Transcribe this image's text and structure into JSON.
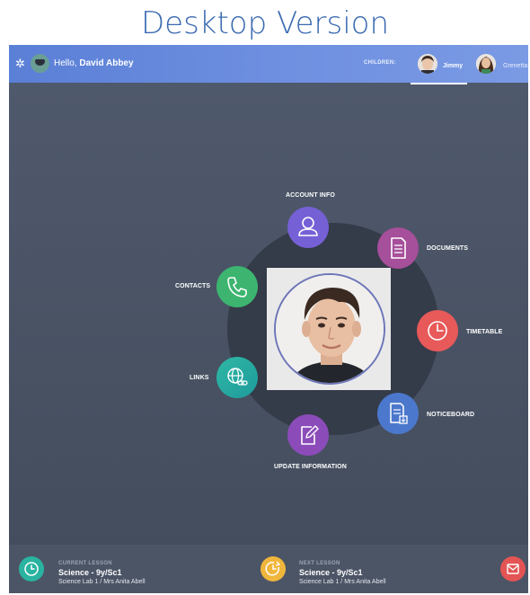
{
  "page_title": "Desktop Version",
  "topbar": {
    "greeting_prefix": "Hello, ",
    "user_name": "David Abbey",
    "children_label": "CHILDREN:",
    "children": [
      {
        "name": "Jimmy",
        "active": true
      },
      {
        "name": "Grenetta",
        "active": false
      }
    ]
  },
  "menu": {
    "account_info": "ACCOUNT INFO",
    "documents": "DOCUMENTS",
    "timetable": "TIMETABLE",
    "noticeboard": "NOTICEBOARD",
    "update_information": "UPDATE INFORMATION",
    "links": "LINKS",
    "contacts": "CONTACTS"
  },
  "lessons": {
    "current": {
      "kicker": "CURRENT LESSON",
      "title": "Science - 9y/Sc1",
      "subtitle": "Science Lab 1 / Mrs Anita Abell"
    },
    "next": {
      "kicker": "NEXT LESSON",
      "title": "Science - 9y/Sc1",
      "subtitle": "Science Lab 1 / Mrs Anita Abell"
    }
  },
  "colors": {
    "topbar": "#6e8fe0",
    "account": "#7660d6",
    "documents": "#a64f9a",
    "timetable": "#e85959",
    "noticeboard": "#4b78cc",
    "update": "#8b4cb9",
    "links": "#2fb8a4",
    "contacts": "#3db570"
  },
  "icons": {
    "settings": "gear-icon",
    "graduation": "graduation-cap-icon",
    "account": "user-icon",
    "documents": "document-icon",
    "timetable": "clock-icon",
    "noticeboard": "notice-download-icon",
    "update": "edit-icon",
    "links": "globe-link-icon",
    "contacts": "phone-icon",
    "current_lesson": "clock-icon",
    "next_lesson": "clock-forward-icon",
    "mail": "mail-icon"
  }
}
